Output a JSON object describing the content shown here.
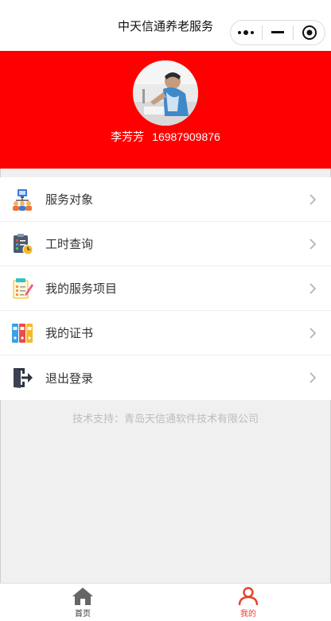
{
  "navbar": {
    "title": "中天信通养老服务"
  },
  "profile": {
    "name": "李芳芳",
    "phone": "16987909876"
  },
  "menu": [
    {
      "label": "服务对象",
      "icon": "people-icon"
    },
    {
      "label": "工时查询",
      "icon": "clipboard-clock-icon"
    },
    {
      "label": "我的服务项目",
      "icon": "notepad-icon"
    },
    {
      "label": "我的证书",
      "icon": "binders-icon"
    },
    {
      "label": "退出登录",
      "icon": "logout-icon"
    }
  ],
  "support_text": "技术支持：青岛天信通软件技术有限公司",
  "tabbar": [
    {
      "label": "首页",
      "icon": "home-icon"
    },
    {
      "label": "我的",
      "icon": "person-icon",
      "active": true
    }
  ],
  "colors": {
    "banner": "#ff0000",
    "active_tab": "#e8402a",
    "page_bg": "#f0f0f0"
  }
}
